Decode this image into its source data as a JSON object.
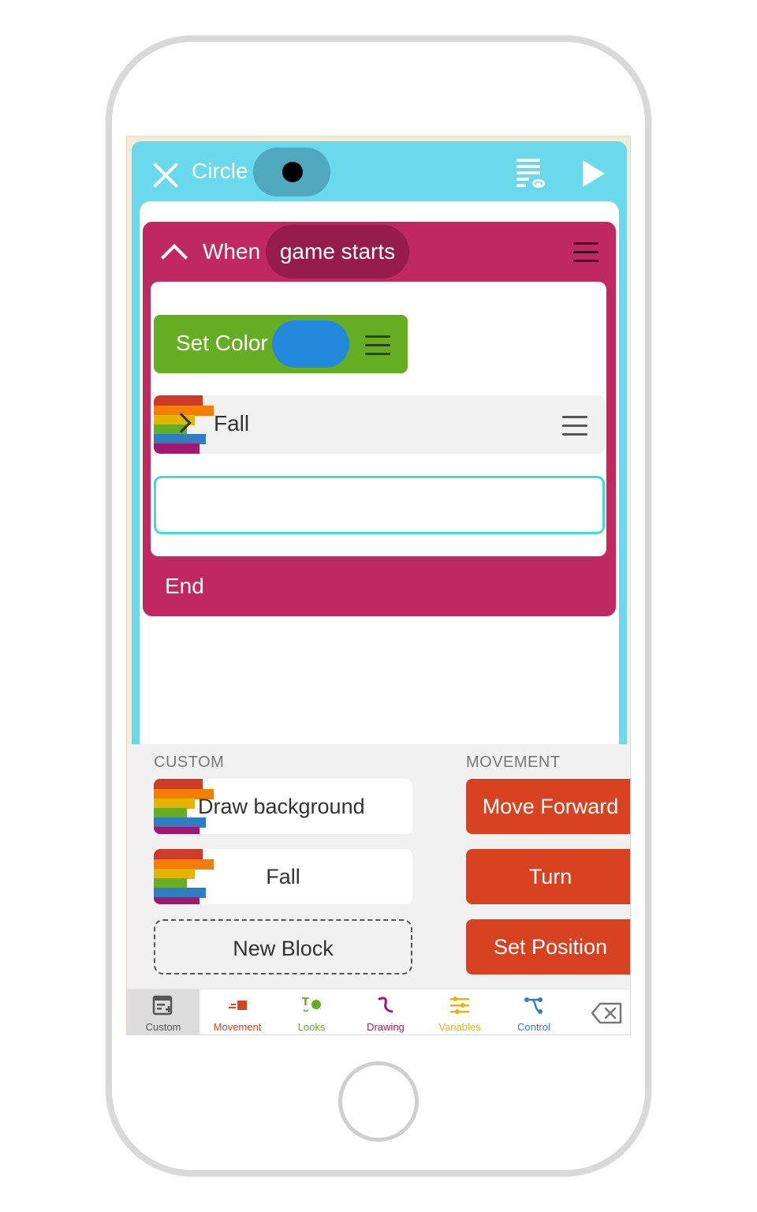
{
  "header": {
    "sprite_name": "Circle"
  },
  "script": {
    "when_label": "When",
    "event": "game starts",
    "end_label": "End",
    "blocks": {
      "set_color": {
        "label": "Set Color",
        "color": "#2389dc"
      },
      "fall": {
        "label": "Fall"
      }
    }
  },
  "palette": {
    "custom": {
      "heading": "CUSTOM",
      "items": [
        "Draw background",
        "Fall"
      ],
      "new_block": "New Block"
    },
    "movement": {
      "heading": "MOVEMENT",
      "items": [
        "Move Forward",
        "Turn",
        "Set Position"
      ]
    }
  },
  "tabs": [
    {
      "label": "Custom",
      "color": "#555555",
      "icon": "custom-block-icon",
      "active": true
    },
    {
      "label": "Movement",
      "color": "#d84220",
      "icon": "movement-icon"
    },
    {
      "label": "Looks",
      "color": "#65ad23",
      "icon": "looks-icon"
    },
    {
      "label": "Drawing",
      "color": "#a3186f",
      "icon": "drawing-icon"
    },
    {
      "label": "Variables",
      "color": "#e6b800",
      "icon": "variables-icon"
    },
    {
      "label": "Control",
      "color": "#2f7fc0",
      "icon": "control-icon"
    }
  ],
  "colors": {
    "topbar": "#6ad9eb",
    "when_block": "#c0295d",
    "event_pill": "#961c4a",
    "set_color_block": "#65ad23",
    "movement_block": "#d84220",
    "drop_slot_border": "#41dcd0"
  }
}
